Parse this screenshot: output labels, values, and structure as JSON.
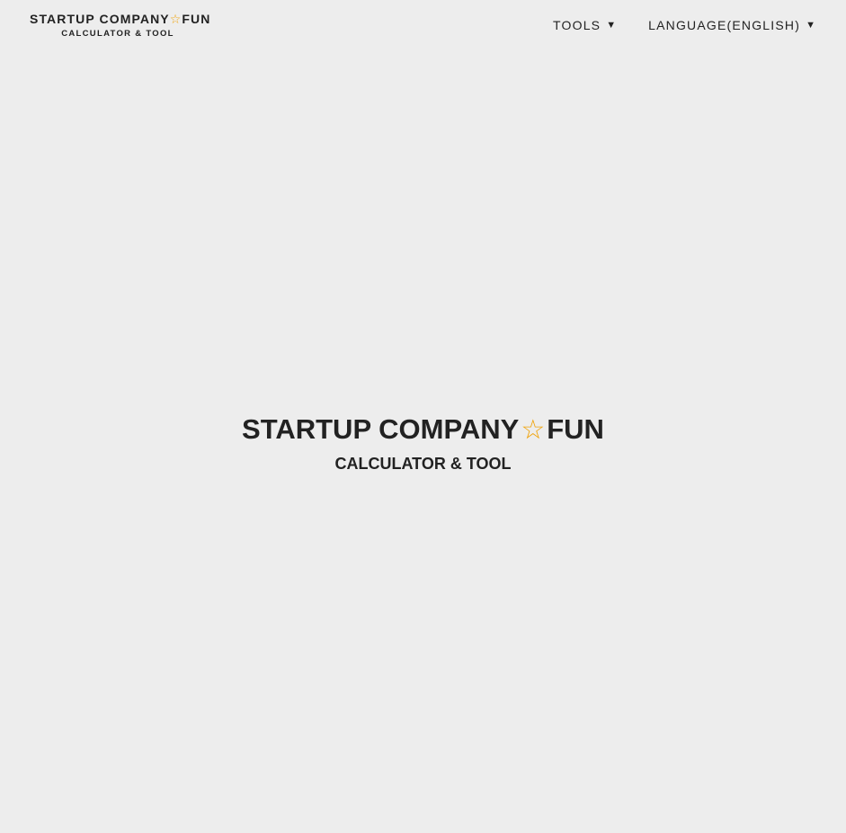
{
  "header": {
    "logo": {
      "title_part1": "STARTUP COMPANY",
      "star": "☆",
      "title_part2": "FUN",
      "subtitle": "CALCULATOR & TOOL"
    },
    "nav": {
      "tools_label": "TOOLS",
      "tools_caret": "▼",
      "language_label": "LANGUAGE(ENGLISH)",
      "language_caret": "▼"
    }
  },
  "hero": {
    "title_part1": "STARTUP COMPANY",
    "star": "☆",
    "title_part2": "FUN",
    "subtitle": "CALCULATOR & TOOL"
  },
  "colors": {
    "background": "#ededed",
    "text": "#222222",
    "star_accent": "#f0a30a"
  }
}
